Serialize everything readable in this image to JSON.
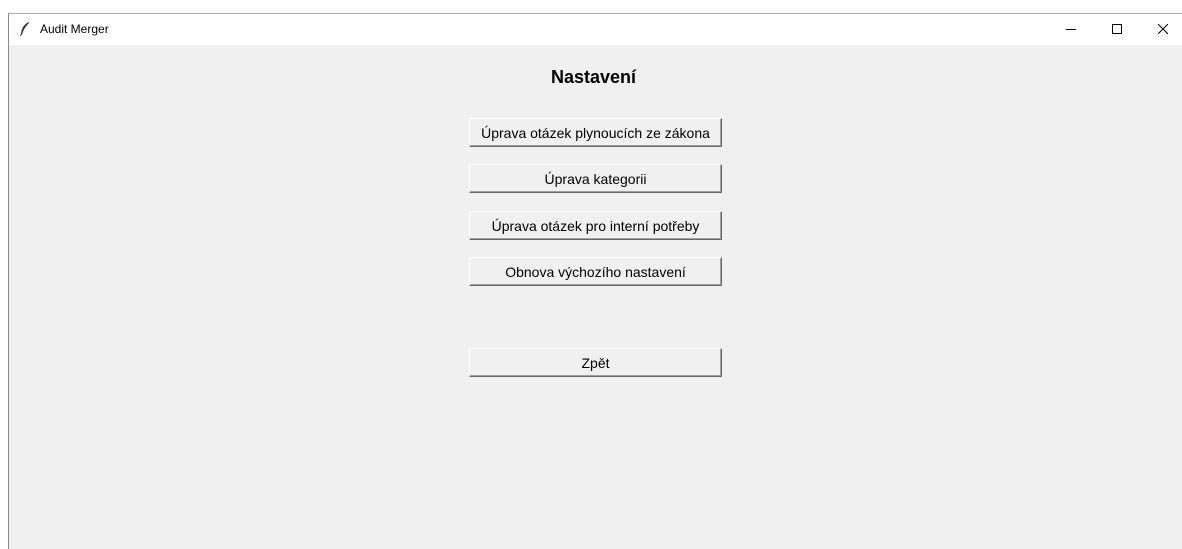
{
  "window": {
    "title": "Audit Merger"
  },
  "settings": {
    "heading": "Nastavení",
    "buttons": {
      "edit_legal_questions": "Úprava otázek plynoucích ze zákona",
      "edit_categories": "Úprava kategorii",
      "edit_internal_questions": "Úprava otázek pro interní potřeby",
      "restore_defaults": "Obnova výchozího nastavení",
      "back": "Zpět"
    }
  },
  "icons": {
    "app": "feather-icon",
    "minimize": "minimize-icon",
    "maximize": "maximize-icon",
    "close": "close-icon"
  }
}
